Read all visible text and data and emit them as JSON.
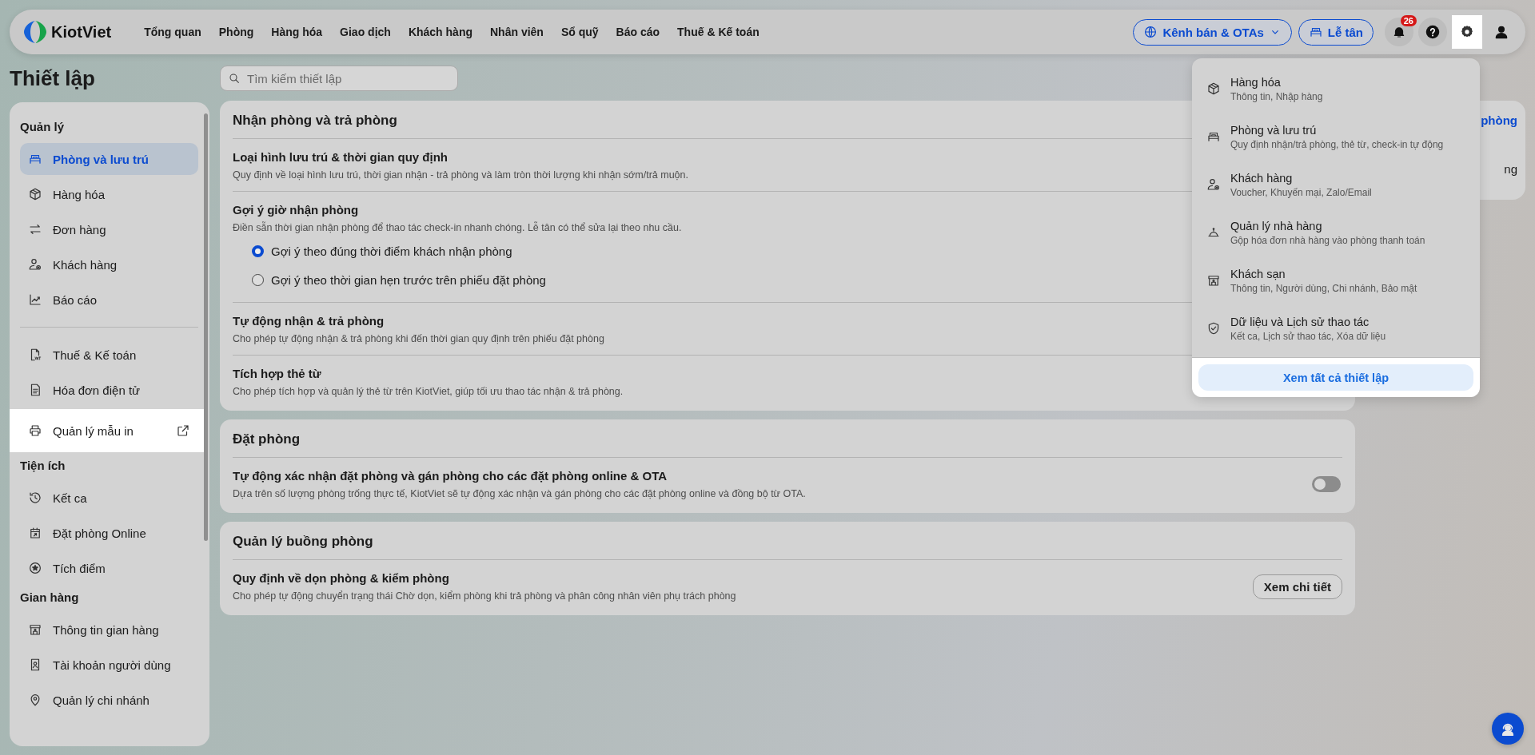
{
  "topbar": {
    "logo": "KiotViet",
    "nav": [
      {
        "label": "Tổng quan",
        "selected": false
      },
      {
        "label": "Phòng",
        "selected": false
      },
      {
        "label": "Hàng hóa",
        "selected": false
      },
      {
        "label": "Giao dịch",
        "selected": false
      },
      {
        "label": "Khách hàng",
        "selected": false
      },
      {
        "label": "Nhân viên",
        "selected": false
      },
      {
        "label": "Sổ quỹ",
        "selected": false
      },
      {
        "label": "Báo cáo",
        "selected": false
      },
      {
        "label": "Thuế & Kế toán",
        "selected": false
      }
    ],
    "channel_button": "Kênh bán & OTAs",
    "reception_button": "Lễ tân",
    "notification_count": "26",
    "settings_spotlight": true
  },
  "page_title": "Thiết lập",
  "search": {
    "placeholder": "Tìm kiếm thiết lập"
  },
  "sidebar": {
    "sections": [
      {
        "title": "Quản lý",
        "groups": [
          [
            {
              "label": "Phòng và lưu trú",
              "selected": true,
              "spotlight": false
            },
            {
              "label": "Hàng hóa",
              "selected": false,
              "spotlight": false
            },
            {
              "label": "Đơn hàng",
              "selected": false,
              "spotlight": false
            },
            {
              "label": "Khách hàng",
              "selected": false,
              "spotlight": false
            },
            {
              "label": "Báo cáo",
              "selected": false,
              "spotlight": false
            }
          ],
          [
            {
              "label": "Thuế & Kế toán",
              "selected": false,
              "spotlight": false
            },
            {
              "label": "Hóa đơn điện tử",
              "selected": false,
              "spotlight": false
            },
            {
              "label": "Quản lý mẫu in",
              "selected": false,
              "spotlight": true,
              "external": true
            }
          ]
        ]
      },
      {
        "title": "Tiện ích",
        "groups": [
          [
            {
              "label": "Kết ca",
              "selected": false,
              "spotlight": false
            },
            {
              "label": "Đặt phòng Online",
              "selected": false,
              "spotlight": false
            },
            {
              "label": "Tích điểm",
              "selected": false,
              "spotlight": false
            }
          ]
        ]
      },
      {
        "title": "Gian hàng",
        "groups": [
          [
            {
              "label": "Thông tin gian hàng",
              "selected": false,
              "spotlight": false
            },
            {
              "label": "Tài khoản người dùng",
              "selected": false,
              "spotlight": false
            },
            {
              "label": "Quản lý chi nhánh",
              "selected": false,
              "spotlight": false
            }
          ]
        ]
      }
    ]
  },
  "sections": [
    {
      "title": "Nhận phòng và trả phòng",
      "rows": [
        {
          "kind": "plain",
          "title": "Loại hình lưu trú & thời gian quy định",
          "description": "Quy định về loại hình lưu trú, thời gian nhận - trả phòng và làm tròn thời lượng khi nhận sớm/trả muộn."
        },
        {
          "kind": "radio",
          "title": "Gợi ý giờ nhận phòng",
          "description": "Điền sẵn thời gian nhận phòng để thao tác check-in nhanh chóng. Lễ tân có thể sửa lại theo nhu cầu.",
          "options": [
            {
              "label": "Gợi ý theo đúng thời điểm khách nhận phòng",
              "selected": true
            },
            {
              "label": "Gợi ý theo thời gian hẹn trước trên phiếu đặt phòng",
              "selected": false
            }
          ]
        },
        {
          "kind": "plain",
          "title": "Tự động nhận & trả phòng",
          "description": "Cho phép tự động nhận & trả phòng khi đến thời gian quy định trên phiếu đặt phòng"
        },
        {
          "kind": "plain",
          "title": "Tích hợp thẻ từ",
          "description": "Cho phép tích hợp và quản lý thẻ từ trên KiotViet, giúp tối ưu thao tác nhận & trả phòng."
        }
      ]
    },
    {
      "title": "Đặt phòng",
      "rows": [
        {
          "kind": "toggle",
          "title": "Tự động xác nhận đặt phòng và gán phòng cho các đặt phòng online & OTA",
          "description": "Dựa trên số lượng phòng trống thực tế, KiotViet sẽ tự động xác nhận và gán phòng cho các đặt phòng online và đồng bộ từ OTA.",
          "on": false
        }
      ]
    },
    {
      "title": "Quản lý buồng phòng",
      "rows": [
        {
          "kind": "button",
          "title": "Quy định về dọn phòng & kiểm phòng",
          "description": "Cho phép tự động chuyển trạng thái Chờ dọn, kiểm phòng khi trả phòng và phân công nhân viên phụ trách phòng",
          "button": "Xem chi tiết"
        }
      ]
    }
  ],
  "side_panel": {
    "link": "phòng",
    "text": "ng"
  },
  "settings_menu": {
    "items": [
      {
        "title": "Hàng hóa",
        "subtitle": "Thông tin, Nhập hàng"
      },
      {
        "title": "Phòng và lưu trú",
        "subtitle": "Quy định nhận/trả phòng, thẻ từ, check-in tự động"
      },
      {
        "title": "Khách hàng",
        "subtitle": "Voucher, Khuyến mại, Zalo/Email"
      },
      {
        "title": "Quản lý nhà hàng",
        "subtitle": "Gộp hóa đơn nhà hàng vào phòng thanh toán"
      },
      {
        "title": "Khách sạn",
        "subtitle": "Thông tin, Người dùng, Chi nhánh, Bảo mật"
      },
      {
        "title": "Dữ liệu và Lịch sử thao tác",
        "subtitle": "Kết ca, Lịch sử thao tác, Xóa dữ liệu"
      }
    ],
    "footer_button": "Xem tất cả thiết lập",
    "footer_spotlight": true
  }
}
